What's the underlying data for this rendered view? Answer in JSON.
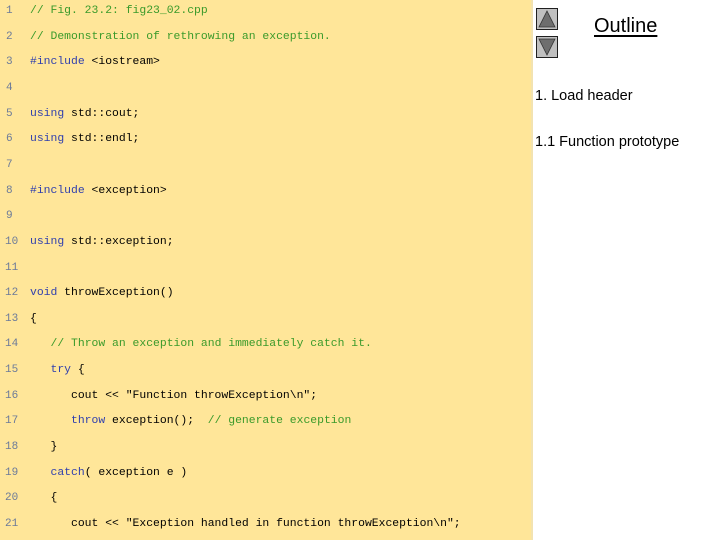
{
  "code": {
    "lines": [
      {
        "num": "1",
        "tokens": [
          {
            "t": "comment",
            "text": "// Fig. 23.2: fig23_02.cpp"
          }
        ]
      },
      {
        "num": "2",
        "tokens": [
          {
            "t": "comment",
            "text": "// Demonstration of rethrowing an exception."
          }
        ]
      },
      {
        "num": "3",
        "tokens": [
          {
            "t": "keyword",
            "text": "#include"
          },
          {
            "t": "plain",
            "text": " <iostream>"
          }
        ]
      },
      {
        "num": "4",
        "tokens": []
      },
      {
        "num": "5",
        "tokens": [
          {
            "t": "keyword",
            "text": "using"
          },
          {
            "t": "plain",
            "text": " std::cout;"
          }
        ]
      },
      {
        "num": "6",
        "tokens": [
          {
            "t": "keyword",
            "text": "using"
          },
          {
            "t": "plain",
            "text": " std::endl;"
          }
        ]
      },
      {
        "num": "7",
        "tokens": []
      },
      {
        "num": "8",
        "tokens": [
          {
            "t": "keyword",
            "text": "#include"
          },
          {
            "t": "plain",
            "text": " <exception>"
          }
        ]
      },
      {
        "num": "9",
        "tokens": []
      },
      {
        "num": "10",
        "tokens": [
          {
            "t": "keyword",
            "text": "using"
          },
          {
            "t": "plain",
            "text": " std::exception;"
          }
        ]
      },
      {
        "num": "11",
        "tokens": []
      },
      {
        "num": "12",
        "tokens": [
          {
            "t": "keyword",
            "text": "void"
          },
          {
            "t": "plain",
            "text": " throwException()"
          }
        ]
      },
      {
        "num": "13",
        "tokens": [
          {
            "t": "plain",
            "text": "{"
          }
        ]
      },
      {
        "num": "14",
        "tokens": [
          {
            "t": "plain",
            "text": "   "
          },
          {
            "t": "comment",
            "text": "// Throw an exception and immediately catch it."
          }
        ]
      },
      {
        "num": "15",
        "tokens": [
          {
            "t": "plain",
            "text": "   "
          },
          {
            "t": "keyword",
            "text": "try"
          },
          {
            "t": "plain",
            "text": " {"
          }
        ]
      },
      {
        "num": "16",
        "tokens": [
          {
            "t": "plain",
            "text": "      cout << \"Function throwException\\n\";"
          }
        ]
      },
      {
        "num": "17",
        "tokens": [
          {
            "t": "plain",
            "text": "      "
          },
          {
            "t": "keyword",
            "text": "throw"
          },
          {
            "t": "plain",
            "text": " exception();  "
          },
          {
            "t": "comment",
            "text": "// generate exception"
          }
        ]
      },
      {
        "num": "18",
        "tokens": [
          {
            "t": "plain",
            "text": "   }"
          }
        ]
      },
      {
        "num": "19",
        "tokens": [
          {
            "t": "plain",
            "text": "   "
          },
          {
            "t": "keyword",
            "text": "catch"
          },
          {
            "t": "plain",
            "text": "( exception e )"
          }
        ]
      },
      {
        "num": "20",
        "tokens": [
          {
            "t": "plain",
            "text": "   {"
          }
        ]
      },
      {
        "num": "21",
        "tokens": [
          {
            "t": "plain",
            "text": "      cout << \"Exception handled in function throwException\\n\";"
          }
        ]
      }
    ]
  },
  "nav": {
    "up_icon": "triangle-up-icon",
    "down_icon": "triangle-down-icon"
  },
  "outline": {
    "title": "Outline",
    "items": [
      {
        "label": "1. Load header"
      },
      {
        "label": "1.1 Function prototype"
      }
    ]
  },
  "colors": {
    "panel_bg": "#FFE699",
    "comment": "#3a9a2a",
    "keyword": "#2f3fae",
    "line_number": "#6b7a99"
  }
}
